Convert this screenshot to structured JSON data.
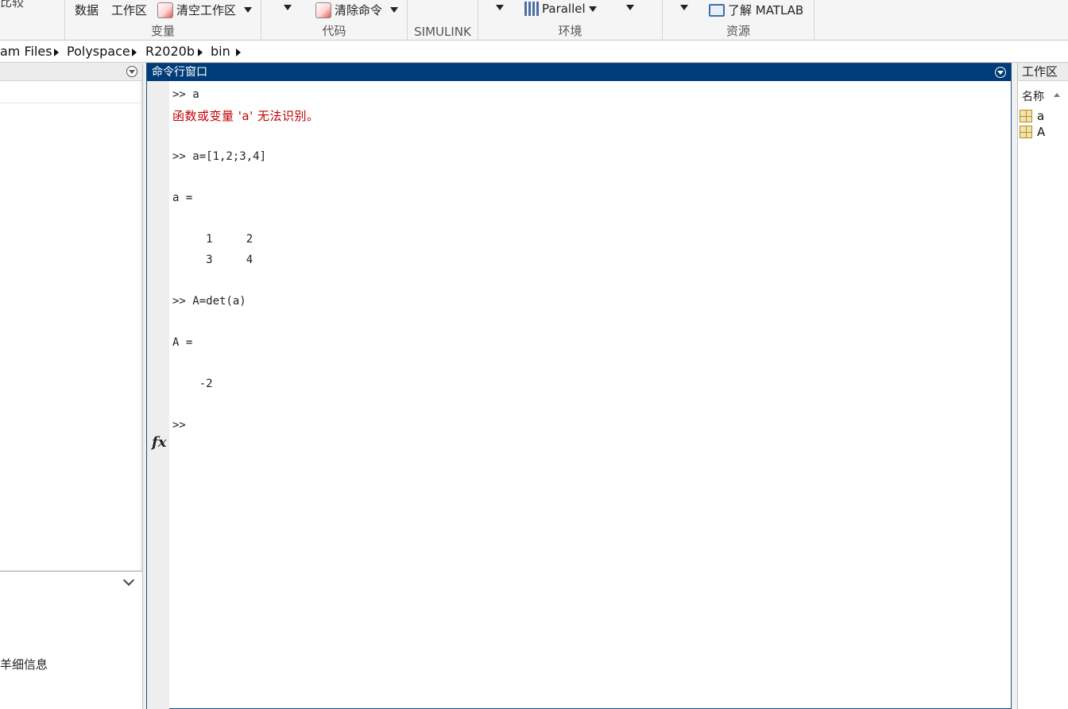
{
  "toolstrip": {
    "truncated_top": "比较",
    "variable_group": {
      "data_label": "数据",
      "workspace_label": "工作区",
      "clear_workspace_label": "清空工作区",
      "group_label": "变量"
    },
    "code_group": {
      "clear_commands_label": "清除命令",
      "group_label": "代码"
    },
    "simulink_group": {
      "group_label": "SIMULINK"
    },
    "environment_group": {
      "parallel_label": "Parallel",
      "group_label": "环境"
    },
    "resources_group": {
      "learn_label": "了解 MATLAB",
      "group_label": "资源"
    }
  },
  "address": {
    "crumbs": [
      "am Files",
      "Polyspace",
      "R2020b",
      "bin"
    ]
  },
  "left_panel": {
    "details_text": "羊细信息"
  },
  "command_window": {
    "title": "命令行窗口",
    "lines": [
      {
        "text": ">> a",
        "type": "input"
      },
      {
        "text": "函数或变量 'a' 无法识别。",
        "type": "error"
      },
      {
        "text": ">> a=[1,2;3,4]",
        "type": "input"
      },
      {
        "text": "a =",
        "type": "output"
      },
      {
        "text": "     1     2",
        "type": "output"
      },
      {
        "text": "     3     4",
        "type": "output"
      },
      {
        "text": ">> A=det(a)",
        "type": "input"
      },
      {
        "text": "A =",
        "type": "output"
      },
      {
        "text": "    -2",
        "type": "output"
      },
      {
        "text": ">>",
        "type": "prompt"
      }
    ],
    "fx_label": "fx"
  },
  "workspace": {
    "title": "工作区",
    "column_name": "名称",
    "variables": [
      "a",
      "A"
    ]
  },
  "colors": {
    "command_title_bg": "#003c78",
    "error_text": "#c00000"
  }
}
